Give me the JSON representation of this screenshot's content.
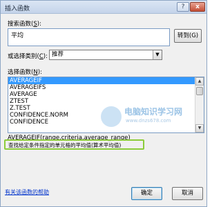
{
  "window": {
    "title": "插入函数",
    "help_glyph": "?",
    "close_glyph": "x"
  },
  "search": {
    "label": "搜索函数(",
    "label_key": "S",
    "label_end": "):",
    "value": "平均",
    "go_label": "转到(G)"
  },
  "category": {
    "label": "或选择类别(",
    "label_key": "C",
    "label_end": "):",
    "selected": "推荐"
  },
  "functions": {
    "label": "选择函数(",
    "label_key": "N",
    "label_end": "):",
    "items": [
      "AVERAGEIF",
      "AVERAGEIFS",
      "AVERAGE",
      "ZTEST",
      "Z.TEST",
      "CONFIDENCE.NORM",
      "CONFIDENCE"
    ],
    "selected_index": 0
  },
  "watermark": {
    "text": "电脑知识学习网",
    "url": "www.dnzs678.com"
  },
  "syntax": "AVERAGEIF(range,criteria,average_range)",
  "description": "查找给定条件指定的单元格的平均值(算术平均值)",
  "footer": {
    "help_link": "有关该函数的帮助",
    "ok": "确定",
    "cancel": "取消"
  }
}
